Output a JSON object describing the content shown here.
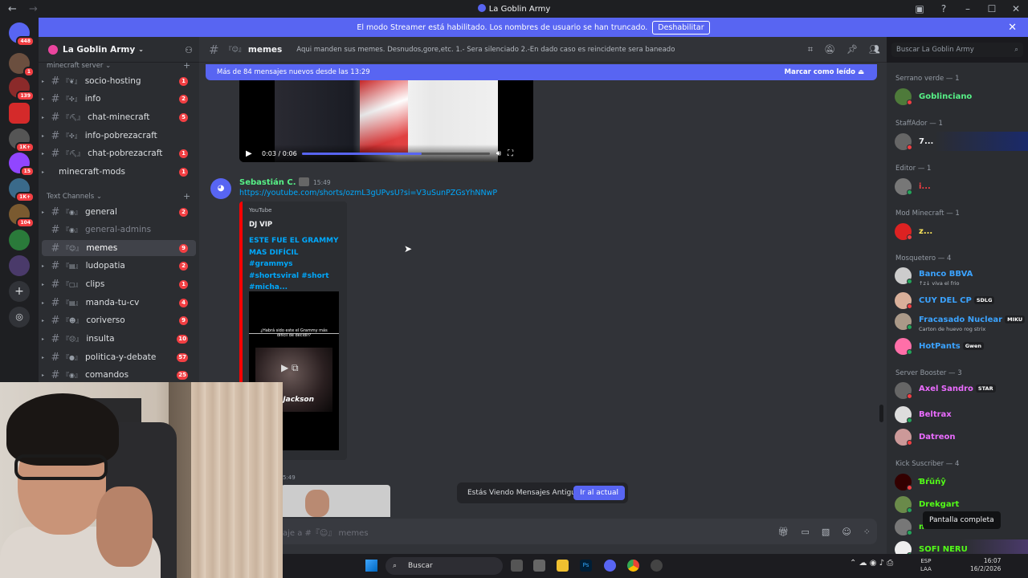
{
  "window": {
    "title": "La Goblin Army"
  },
  "banner": {
    "text": "El modo Streamer está habilitado. Los nombres de usuario se han truncado.",
    "button": "Deshabilitar"
  },
  "rail": {
    "badges": [
      "448",
      "1",
      "139",
      "1K+",
      "15",
      "1K+",
      "104"
    ]
  },
  "server": {
    "name": "La Goblin Army",
    "categories": [
      {
        "label": "minecraft server"
      },
      {
        "label": "Text Channels"
      }
    ],
    "channels": [
      {
        "name": "socio-hosting",
        "emoji": "『❦』",
        "count": "1"
      },
      {
        "name": "info",
        "emoji": "『✣』",
        "count": "2"
      },
      {
        "name": "chat-minecraft",
        "emoji": "『⛏』",
        "count": "5"
      },
      {
        "name": "info-pobrezacraft",
        "emoji": "『✣』",
        "count": ""
      },
      {
        "name": "chat-pobrezacraft",
        "emoji": "『⛏』",
        "count": "1"
      },
      {
        "name": "minecraft-mods",
        "emoji": "",
        "count": "1"
      },
      {
        "name": "general",
        "emoji": "『◉』",
        "count": "2"
      },
      {
        "name": "general-admins",
        "emoji": "『◉』",
        "count": ""
      },
      {
        "name": "memes",
        "emoji": "『☺』",
        "count": "9"
      },
      {
        "name": "ludopatia",
        "emoji": "『▤』",
        "count": "2"
      },
      {
        "name": "clips",
        "emoji": "『▢』",
        "count": "1"
      },
      {
        "name": "manda-tu-cv",
        "emoji": "『▤』",
        "count": "4"
      },
      {
        "name": "coriverso",
        "emoji": "『☻』",
        "count": "9"
      },
      {
        "name": "insulta",
        "emoji": "『☹』",
        "count": "10"
      },
      {
        "name": "politica-y-debate",
        "emoji": "『●』",
        "count": "57"
      },
      {
        "name": "comandos",
        "emoji": "『◉』",
        "count": "25"
      }
    ]
  },
  "channel": {
    "name": "memes",
    "emoji": "『☺』",
    "topic": "Aqui manden sus memes. Desnudos,gore,etc. 1.- Sera silenciado 2.-En dado caso es reincidente sera baneado"
  },
  "search": {
    "placeholder": "Buscar La Goblin Army"
  },
  "new_messages": {
    "text": "Más de 84 mensajes nuevos desde las 13:29",
    "action": "Marcar como leído"
  },
  "video": {
    "time": "0:03 / 0:06",
    "progress": 0.64
  },
  "message": {
    "author": "Sebastián C.",
    "time": "15:49",
    "link": "https://youtube.com/shorts/ozmL3gUPvsU?si=V3uSunPZGsYhNNwP",
    "embed": {
      "provider": "YouTube",
      "author": "DJ VIP",
      "title": "ESTE FUE EL GRAMMY MAS DIFÍCIL #grammys #shortsviral #short #micha...",
      "thumb_text": "¿Habrá sido este el Grammy más difícil de decidir?",
      "thumb_caption": "el Jackson"
    }
  },
  "prev_time": "5:49",
  "old_messages": {
    "text": "Estás Viendo Mensajes Antiguos",
    "button": "Ir al actual"
  },
  "composer": {
    "placeholder": "aje a #『☺』 memes"
  },
  "members": {
    "groups": [
      {
        "label": "Serrano verde — 1"
      },
      {
        "label": "StaffAdor — 1"
      },
      {
        "label": "Editor — 1"
      },
      {
        "label": "Mod Minecraft — 1"
      },
      {
        "label": "Mosquetero — 4"
      },
      {
        "label": "Server Booster — 3"
      },
      {
        "label": "Kick Suscriber — 4"
      }
    ],
    "list": [
      {
        "name": "Goblinciano",
        "sub": "",
        "pill": "",
        "color": "#57f287"
      },
      {
        "name": "7...",
        "sub": "",
        "pill": "",
        "color": "#f2f3f5"
      },
      {
        "name": "i...",
        "sub": "",
        "pill": "",
        "color": "#f23f43"
      },
      {
        "name": "z...",
        "sub": "",
        "pill": "",
        "color": "#fee75c"
      },
      {
        "name": "Banco BBVA",
        "sub": "↑z↓ viva el frio",
        "pill": "",
        "color": "#3ba3ff"
      },
      {
        "name": "CUY DEL CP",
        "sub": "",
        "pill": "SDLG",
        "color": "#3ba3ff"
      },
      {
        "name": "Fracasado Nuclear",
        "sub": "Carton de huevo rog strix",
        "pill": "MIKU",
        "color": "#3ba3ff"
      },
      {
        "name": "HotPants",
        "sub": "",
        "pill": "Gwen",
        "color": "#3ba3ff"
      },
      {
        "name": "Axel Sandro",
        "sub": "",
        "pill": "STAR",
        "color": "#eb6cff"
      },
      {
        "name": "Beltrax",
        "sub": "",
        "pill": "",
        "color": "#eb6cff"
      },
      {
        "name": "Datreon",
        "sub": "",
        "pill": "",
        "color": "#eb6cff"
      },
      {
        "name": "Ɓŕŭńŷ",
        "sub": "",
        "pill": "",
        "color": "#53fc18"
      },
      {
        "name": "Drekgart",
        "sub": "",
        "pill": "",
        "color": "#53fc18"
      },
      {
        "name": "m...",
        "sub": "",
        "pill": "",
        "color": "#53fc18"
      },
      {
        "name": "SOFI NERU",
        "sub": "",
        "pill": "",
        "color": "#53fc18"
      }
    ]
  },
  "tooltip": "Pantalla completa",
  "taskbar": {
    "search": "Buscar",
    "lang_top": "ESP",
    "lang_bottom": "LAA",
    "time": "16:07",
    "date": "16/2/2026"
  }
}
